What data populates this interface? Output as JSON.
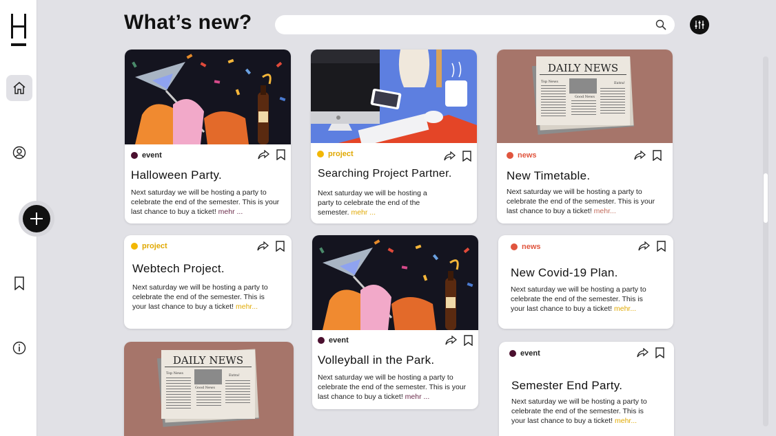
{
  "header": {
    "title": "What’s new?",
    "search_placeholder": ""
  },
  "sidebar": {
    "logo": "H",
    "items": [
      "home-icon",
      "profile-icon",
      "add-icon",
      "bookmark-icon",
      "info-icon"
    ]
  },
  "colors": {
    "event": "#4a0f2e",
    "project": "#f2b705",
    "news": "#e0553e"
  },
  "cards": [
    {
      "tag": "event",
      "title": "Halloween Party.",
      "desc": "Next saturday we will be hosting a party to celebrate the end of  the semester. This is your last chance to buy a ticket!",
      "more": "mehr ..."
    },
    {
      "tag": "project",
      "title": "Searching Project Partner.",
      "desc": "Next saturday we will be hosting a party to celebrate the end of  the semester.",
      "more": "mehr ..."
    },
    {
      "tag": "news",
      "title": "New Timetable.",
      "desc": "Next saturday we will be hosting a party to celebrate the end of  the semester. This is your last chance to buy a ticket!",
      "more": "mehr..."
    },
    {
      "tag": "project",
      "title": "Webtech Project.",
      "desc": "Next saturday we will be hosting a party to celebrate the end of  the semester. This is your last chance to buy a ticket!",
      "more": "mehr..."
    },
    {
      "tag": "event",
      "title": "Volleyball in the Park.",
      "desc": "Next saturday we will be hosting a party to celebrate the end of  the semester. This is your last chance to buy a ticket!",
      "more": "mehr ..."
    },
    {
      "tag": "news",
      "title": "New Covid-19 Plan.",
      "desc": "Next saturday we will be hosting a party to celebrate the end of  the semester. This is your last chance to buy a ticket!",
      "more": "mehr..."
    },
    {
      "tag": "event",
      "title": "Semester End Party.",
      "desc": "Next saturday we will be hosting a party to celebrate the end of  the semester. This is your last chance to buy a ticket!",
      "more": "mehr..."
    }
  ],
  "newspaper": {
    "masthead": "DAILY NEWS",
    "left": "Top News",
    "right": "Extra!",
    "mid": "Good News"
  }
}
